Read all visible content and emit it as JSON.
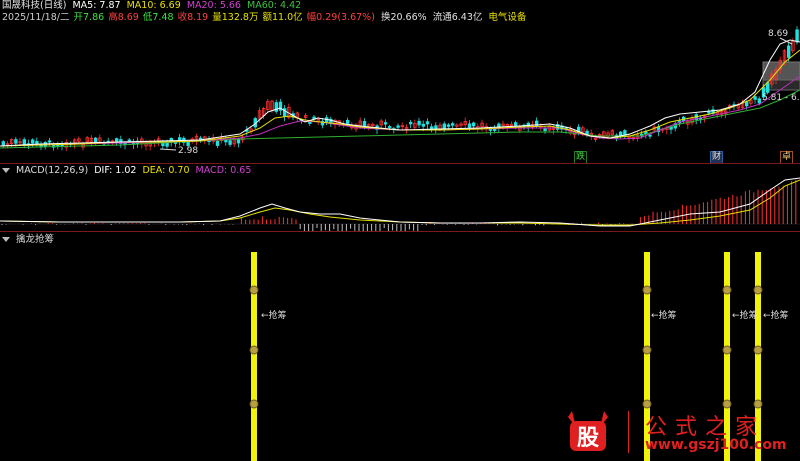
{
  "header": {
    "stock_name": "国晟科技(日线)",
    "ma5_label": "MA5: 7.87",
    "ma10_label": "MA10: 6.69",
    "ma20_label": "MA20: 5.66",
    "ma60_label": "MA60: 4.42"
  },
  "quote": {
    "date": "2025/11/18/二",
    "open": "开7.86",
    "high": "高8.69",
    "low": "低7.48",
    "close": "收8.19",
    "volume": "量132.8万",
    "amount": "额11.0亿",
    "change": "幅0.29(3.67%)",
    "turnover": "换20.66%",
    "float_cap": "流通6.43亿",
    "industry": "电气设备"
  },
  "price_chart": {
    "high_marker": "8.69",
    "low_marker": "2.98",
    "right_marker": "5.81 - 6.3",
    "badges": {
      "die": "跌",
      "cai": "财",
      "zhuo": "卓"
    },
    "colors": {
      "ma5": "#ffffff",
      "ma10": "#e8e000",
      "ma20": "#c030c0",
      "ma60": "#30b030",
      "up": "#ff3030",
      "down": "#20e0e0"
    }
  },
  "macd": {
    "title": "MACD(12,26,9)",
    "dif": "DIF: 1.02",
    "dea": "DEA: 0.70",
    "macd": "MACD: 0.65"
  },
  "indicator": {
    "title": "擒龙抢筹",
    "signal_label": "抢筹",
    "bar_color": "#f2f20a"
  },
  "watermark": {
    "logo_char": "股",
    "site_name": "公式之家",
    "url": "www.gszj100.com"
  }
}
